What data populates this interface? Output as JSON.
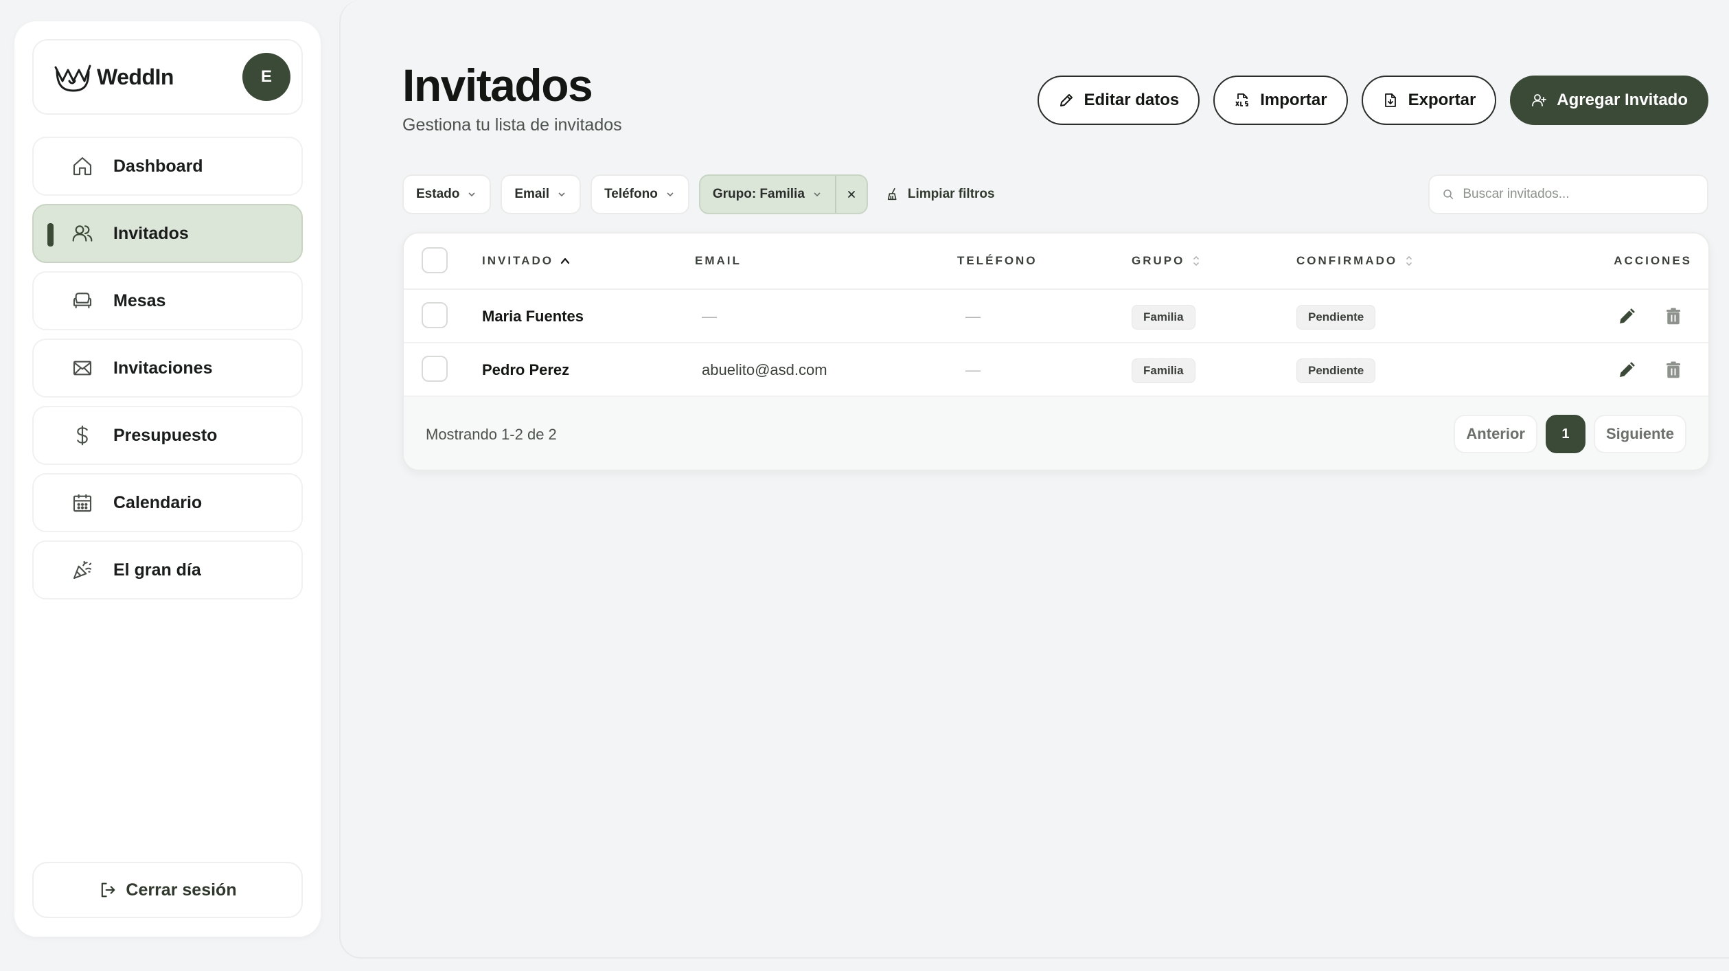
{
  "brand": {
    "name": "WeddIn",
    "avatar_initial": "E"
  },
  "sidebar": {
    "items": [
      {
        "label": "Dashboard",
        "icon": "home-icon"
      },
      {
        "label": "Invitados",
        "icon": "users-icon",
        "active": true
      },
      {
        "label": "Mesas",
        "icon": "sofa-icon"
      },
      {
        "label": "Invitaciones",
        "icon": "mail-icon"
      },
      {
        "label": "Presupuesto",
        "icon": "dollar-icon"
      },
      {
        "label": "Calendario",
        "icon": "calendar-icon"
      },
      {
        "label": "El gran día",
        "icon": "party-popper-icon"
      }
    ],
    "logout_label": "Cerrar sesión"
  },
  "header": {
    "title": "Invitados",
    "subtitle": "Gestiona tu lista de invitados",
    "buttons": {
      "edit": "Editar datos",
      "import": "Importar",
      "export": "Exportar",
      "add": "Agregar Invitado"
    }
  },
  "filters": {
    "estado": "Estado",
    "email": "Email",
    "telefono": "Teléfono",
    "grupo": "Grupo: Familia",
    "clear": "Limpiar filtros"
  },
  "search": {
    "placeholder": "Buscar invitados..."
  },
  "table": {
    "columns": {
      "invitado": "INVITADO",
      "email": "EMAIL",
      "telefono": "TELÉFONO",
      "grupo": "GRUPO",
      "confirmado": "CONFIRMADO",
      "acciones": "ACCIONES"
    },
    "rows": [
      {
        "name": "Maria Fuentes",
        "email": "—",
        "phone": "—",
        "group": "Familia",
        "status": "Pendiente"
      },
      {
        "name": "Pedro Perez",
        "email": "abuelito@asd.com",
        "phone": "—",
        "group": "Familia",
        "status": "Pendiente"
      }
    ],
    "showing": "Mostrando 1-2 de 2"
  },
  "pagination": {
    "prev": "Anterior",
    "current": "1",
    "next": "Siguiente"
  },
  "colors": {
    "accent": "#3a4a37",
    "active_bg": "#dce6d8",
    "background": "#f3f4f5"
  }
}
